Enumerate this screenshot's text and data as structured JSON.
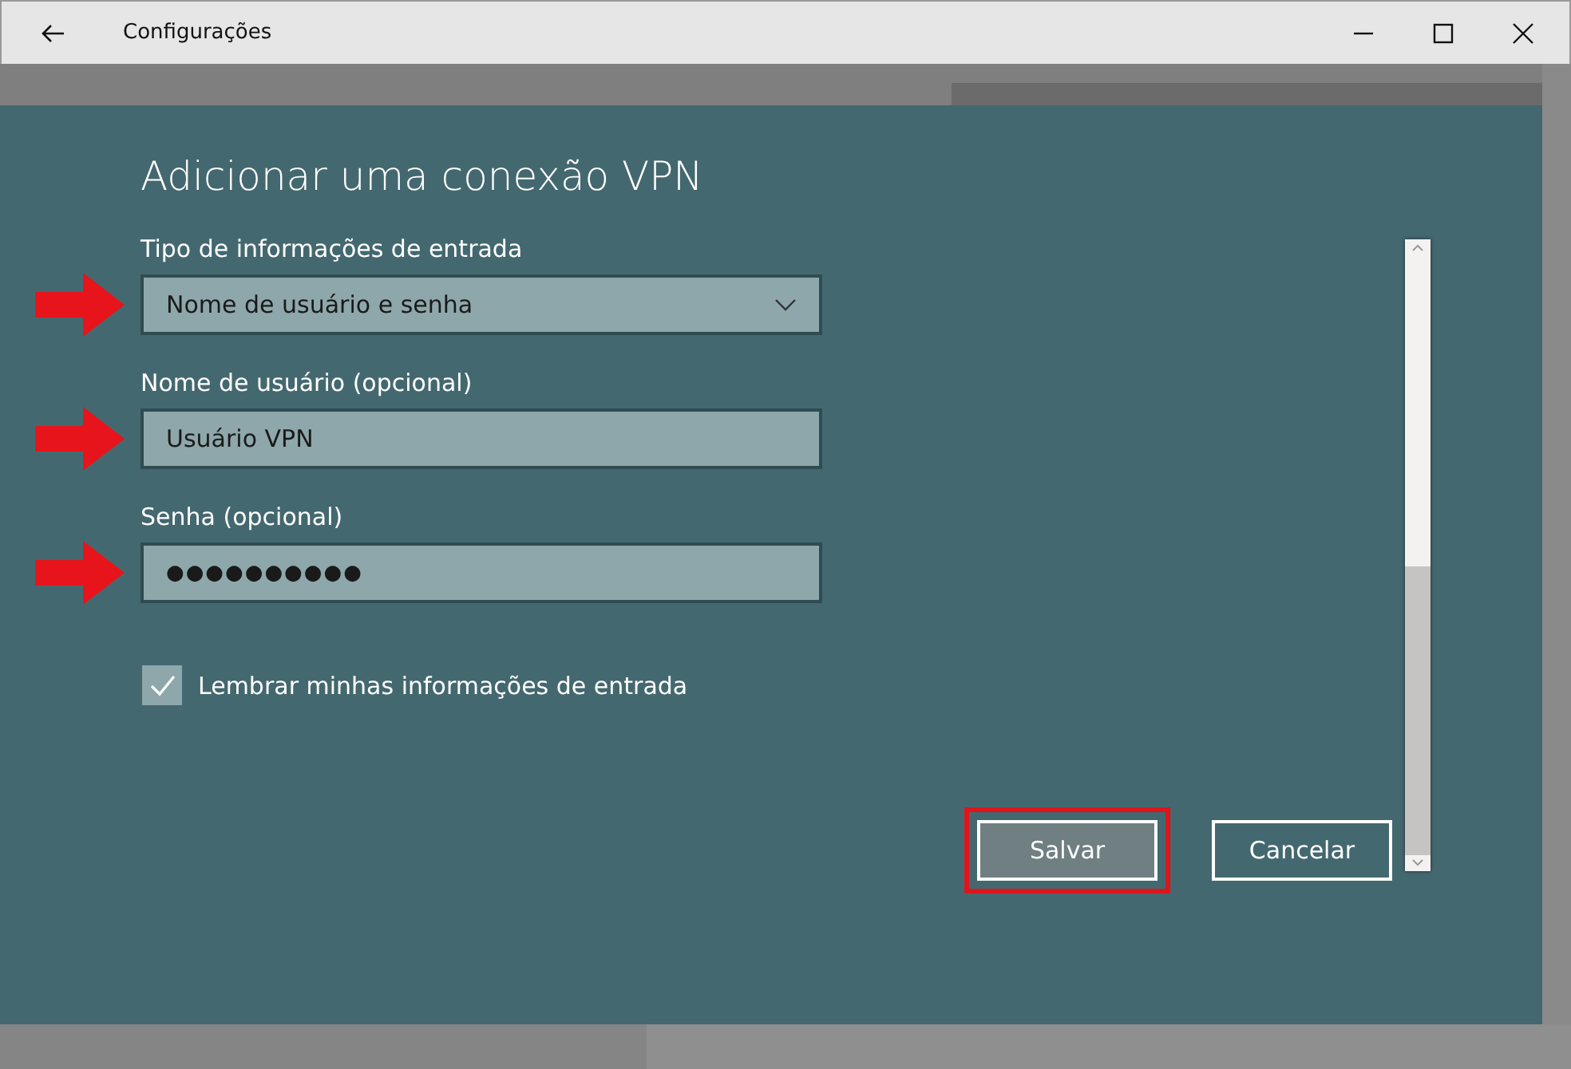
{
  "window": {
    "title": "Configurações"
  },
  "dialog": {
    "title": "Adicionar uma conexão VPN",
    "fields": [
      {
        "kind": "dropdown",
        "label": "Tipo de informações de entrada",
        "value": "Nome de usuário e senha",
        "pointed": true
      },
      {
        "kind": "text",
        "label": "Nome de usuário (opcional)",
        "value": "Usuário VPN",
        "pointed": true
      },
      {
        "kind": "password",
        "label": "Senha (opcional)",
        "value": "●●●●●●●●●●",
        "pointed": true
      }
    ],
    "checkbox": {
      "label": "Lembrar minhas informações de entrada",
      "checked": true
    },
    "buttons": [
      {
        "label": "Salvar",
        "highlighted": true
      },
      {
        "label": "Cancelar",
        "highlighted": false
      }
    ]
  }
}
